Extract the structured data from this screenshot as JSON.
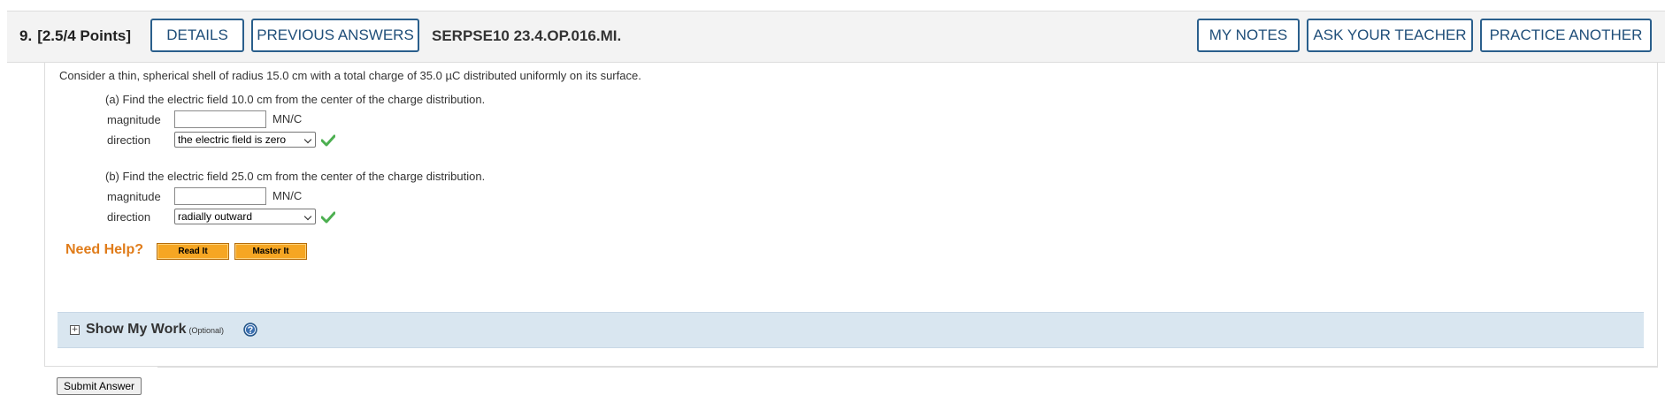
{
  "header": {
    "question_number": "9.",
    "points": "[2.5/4 Points]",
    "details_label": "DETAILS",
    "previous_answers_label": "PREVIOUS ANSWERS",
    "question_id": "SERPSE10 23.4.OP.016.MI.",
    "my_notes_label": "MY NOTES",
    "ask_teacher_label": "ASK YOUR TEACHER",
    "practice_another_label": "PRACTICE ANOTHER"
  },
  "question": {
    "intro": "Consider a thin, spherical shell of radius 15.0 cm with a total charge of 35.0 µC distributed uniformly on its surface.",
    "parts": [
      {
        "prompt": "(a) Find the electric field 10.0 cm from the center of the charge distribution.",
        "magnitude_label": "magnitude",
        "magnitude_value": "",
        "unit": "MN/C",
        "direction_label": "direction",
        "direction_value": "the electric field is zero",
        "correct": true
      },
      {
        "prompt": "(b) Find the electric field 25.0 cm from the center of the charge distribution.",
        "magnitude_label": "magnitude",
        "magnitude_value": "",
        "unit": "MN/C",
        "direction_label": "direction",
        "direction_value": "radially outward",
        "correct": true
      }
    ]
  },
  "help": {
    "label": "Need Help?",
    "read_it_label": "Read It",
    "master_it_label": "Master It"
  },
  "show_my_work": {
    "expand_glyph": "+",
    "title": "Show My Work",
    "optional_label": "(Optional)"
  },
  "submit_label": "Submit Answer",
  "colors": {
    "accent_blue": "#1f4e79",
    "help_orange": "#e07c1a",
    "button_orange": "#f6a623",
    "check_green": "#4caf50",
    "work_panel_bg": "#d9e6f0"
  },
  "icons": {
    "check": "check-icon",
    "expand": "plus-box-icon",
    "help": "question-circle-icon"
  }
}
